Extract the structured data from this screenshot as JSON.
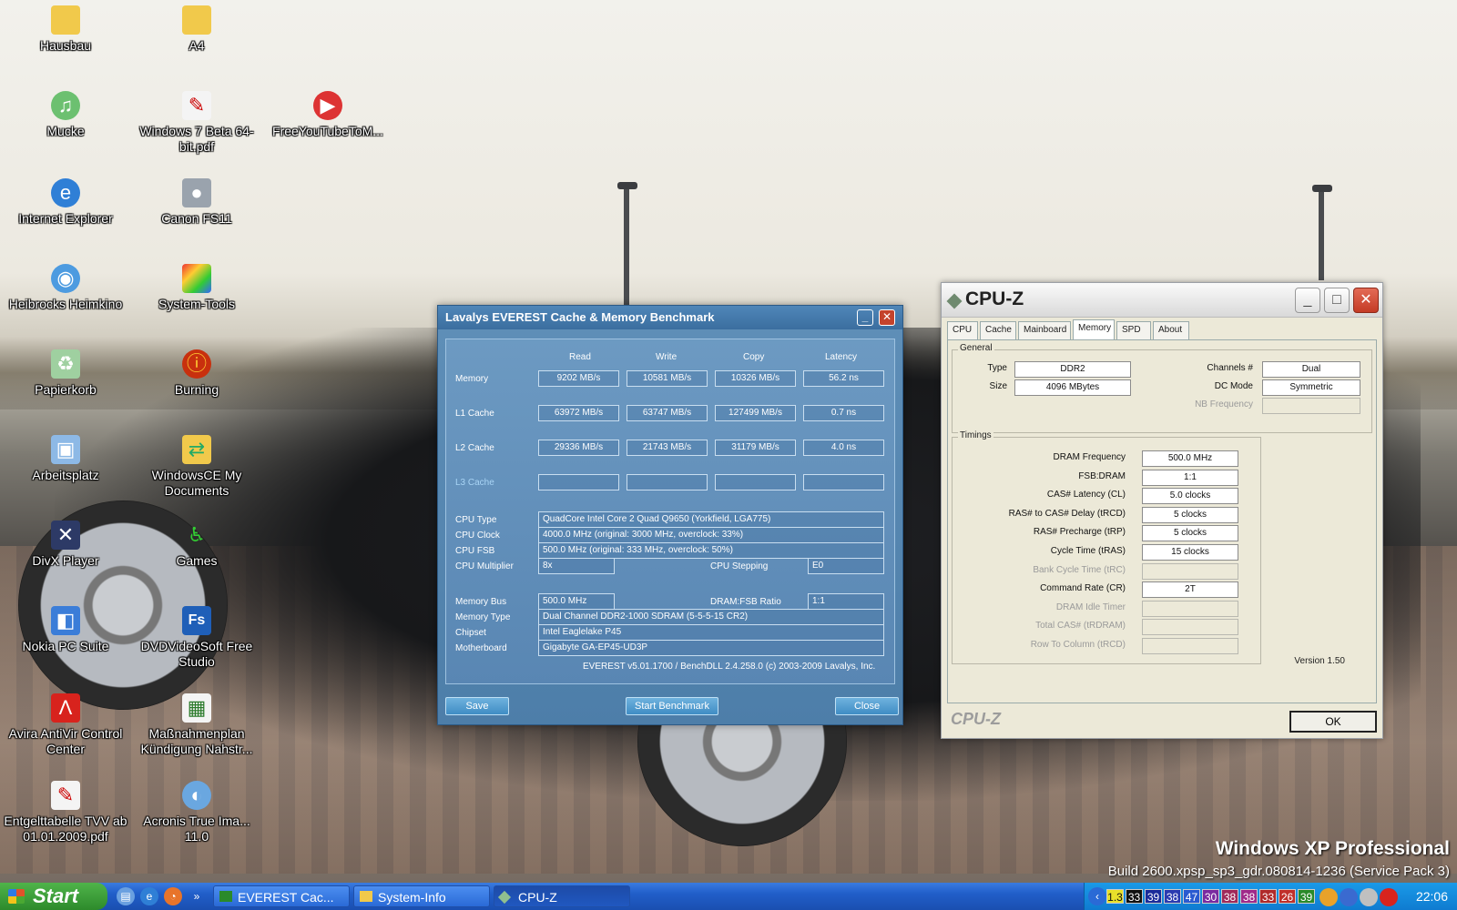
{
  "desktop": {
    "icons": [
      {
        "label": "Hausbau",
        "icon": "folder-icon"
      },
      {
        "label": "A4",
        "icon": "folder-icon"
      },
      {
        "label": "Mucke",
        "icon": "music-cd-icon"
      },
      {
        "label": "Windows 7 Beta 64-bit.pdf",
        "icon": "pdf-icon"
      },
      {
        "label": "FreeYouTubeToM...",
        "icon": "youtube-converter-icon"
      },
      {
        "label": "Internet Explorer",
        "icon": "internet-explorer-icon"
      },
      {
        "label": "Canon FS11",
        "icon": "camcorder-icon"
      },
      {
        "label": "Heibrocks Heimkino",
        "icon": "network-icon"
      },
      {
        "label": "System-Tools",
        "icon": "tools-icon"
      },
      {
        "label": "Papierkorb",
        "icon": "recycle-bin-icon"
      },
      {
        "label": "Burning",
        "icon": "burning-icon"
      },
      {
        "label": "Arbeitsplatz",
        "icon": "my-computer-icon"
      },
      {
        "label": "WindowsCE My Documents",
        "icon": "sync-folder-icon"
      },
      {
        "label": "DivX Player",
        "icon": "divx-icon"
      },
      {
        "label": "Games",
        "icon": "games-icon"
      },
      {
        "label": "Nokia PC Suite",
        "icon": "nokia-icon"
      },
      {
        "label": "DVDVideoSoft Free Studio",
        "icon": "dvdvideosoft-icon"
      },
      {
        "label": "Avira AntiVir Control Center",
        "icon": "avira-icon"
      },
      {
        "label": "Maßnahmenplan Kündigung Nahstr...",
        "icon": "excel-icon"
      },
      {
        "label": "Entgelttabelle TVV ab 01.01.2009.pdf",
        "icon": "pdf-icon"
      },
      {
        "label": "Acronis True Ima... 11.0",
        "icon": "acronis-icon"
      }
    ]
  },
  "everest": {
    "title": "Lavalys EVEREST Cache & Memory Benchmark",
    "columns": [
      "Read",
      "Write",
      "Copy",
      "Latency"
    ],
    "rows": [
      {
        "label": "Memory",
        "values": [
          "9202 MB/s",
          "10581 MB/s",
          "10326 MB/s",
          "56.2 ns"
        ]
      },
      {
        "label": "L1 Cache",
        "values": [
          "63972 MB/s",
          "63747 MB/s",
          "127499 MB/s",
          "0.7 ns"
        ]
      },
      {
        "label": "L2 Cache",
        "values": [
          "29336 MB/s",
          "21743 MB/s",
          "31179 MB/s",
          "4.0 ns"
        ]
      },
      {
        "label": "L3 Cache",
        "values": [
          "",
          "",
          "",
          ""
        ]
      }
    ],
    "info": {
      "cpu_type_label": "CPU Type",
      "cpu_type": "QuadCore Intel Core 2 Quad Q9650  (Yorkfield, LGA775)",
      "cpu_clock_label": "CPU Clock",
      "cpu_clock": "4000.0 MHz  (original: 3000 MHz, overclock: 33%)",
      "cpu_fsb_label": "CPU FSB",
      "cpu_fsb": "500.0 MHz  (original: 333 MHz, overclock: 50%)",
      "cpu_mult_label": "CPU Multiplier",
      "cpu_mult": "8x",
      "cpu_step_label": "CPU Stepping",
      "cpu_step": "E0",
      "mem_bus_label": "Memory Bus",
      "mem_bus": "500.0 MHz",
      "dram_ratio_label": "DRAM:FSB Ratio",
      "dram_ratio": "1:1",
      "mem_type_label": "Memory Type",
      "mem_type": "Dual Channel DDR2-1000 SDRAM  (5-5-5-15 CR2)",
      "chipset_label": "Chipset",
      "chipset": "Intel Eaglelake P45",
      "mobo_label": "Motherboard",
      "mobo": "Gigabyte GA-EP45-UD3P"
    },
    "footer_text": "EVEREST v5.01.1700 / BenchDLL 2.4.258.0  (c) 2003-2009 Lavalys, Inc.",
    "buttons": {
      "save": "Save",
      "start": "Start Benchmark",
      "close": "Close"
    }
  },
  "cpuz": {
    "title": "CPU-Z",
    "tabs": [
      "CPU",
      "Cache",
      "Mainboard",
      "Memory",
      "SPD",
      "About"
    ],
    "active_tab": "Memory",
    "general": {
      "group_title": "General",
      "type_label": "Type",
      "type": "DDR2",
      "size_label": "Size",
      "size": "4096 MBytes",
      "channels_label": "Channels #",
      "channels": "Dual",
      "dcmode_label": "DC Mode",
      "dcmode": "Symmetric",
      "nbfreq_label": "NB Frequency",
      "nbfreq": ""
    },
    "timings": {
      "group_title": "Timings",
      "rows": [
        {
          "label": "DRAM Frequency",
          "value": "500.0 MHz",
          "enabled": true
        },
        {
          "label": "FSB:DRAM",
          "value": "1:1",
          "enabled": true
        },
        {
          "label": "CAS# Latency (CL)",
          "value": "5.0 clocks",
          "enabled": true
        },
        {
          "label": "RAS# to CAS# Delay (tRCD)",
          "value": "5 clocks",
          "enabled": true
        },
        {
          "label": "RAS# Precharge (tRP)",
          "value": "5 clocks",
          "enabled": true
        },
        {
          "label": "Cycle Time (tRAS)",
          "value": "15 clocks",
          "enabled": true
        },
        {
          "label": "Bank Cycle Time (tRC)",
          "value": "",
          "enabled": false
        },
        {
          "label": "Command Rate (CR)",
          "value": "2T",
          "enabled": true
        },
        {
          "label": "DRAM Idle Timer",
          "value": "",
          "enabled": false
        },
        {
          "label": "Total CAS# (tRDRAM)",
          "value": "",
          "enabled": false
        },
        {
          "label": "Row To Column (tRCD)",
          "value": "",
          "enabled": false
        }
      ]
    },
    "version": "Version 1.50",
    "brand": "CPU-Z",
    "ok": "OK"
  },
  "watermark": {
    "line1": "Windows XP Professional",
    "line2": "Build 2600.xpsp_sp3_gdr.080814-1236 (Service Pack 3)"
  },
  "taskbar": {
    "start": "Start",
    "chevron": "»",
    "tasks": [
      {
        "label": "EVEREST Cac...",
        "icon": "everest-icon"
      },
      {
        "label": "System-Info",
        "icon": "folder-icon"
      },
      {
        "label": "CPU-Z",
        "icon": "cpuz-icon"
      }
    ],
    "tray_numbers": [
      "1.3",
      "33",
      "39",
      "38",
      "47",
      "30",
      "38",
      "38",
      "33",
      "26",
      "39"
    ],
    "tray_colors": [
      "#e8e02a",
      "#111111",
      "#1a2a9a",
      "#2a3ab0",
      "#2a5ad0",
      "#7a2aa0",
      "#a02a5a",
      "#a02a8a",
      "#b02a2a",
      "#c0302a",
      "#2a8a2a"
    ],
    "clock": "22:06"
  }
}
